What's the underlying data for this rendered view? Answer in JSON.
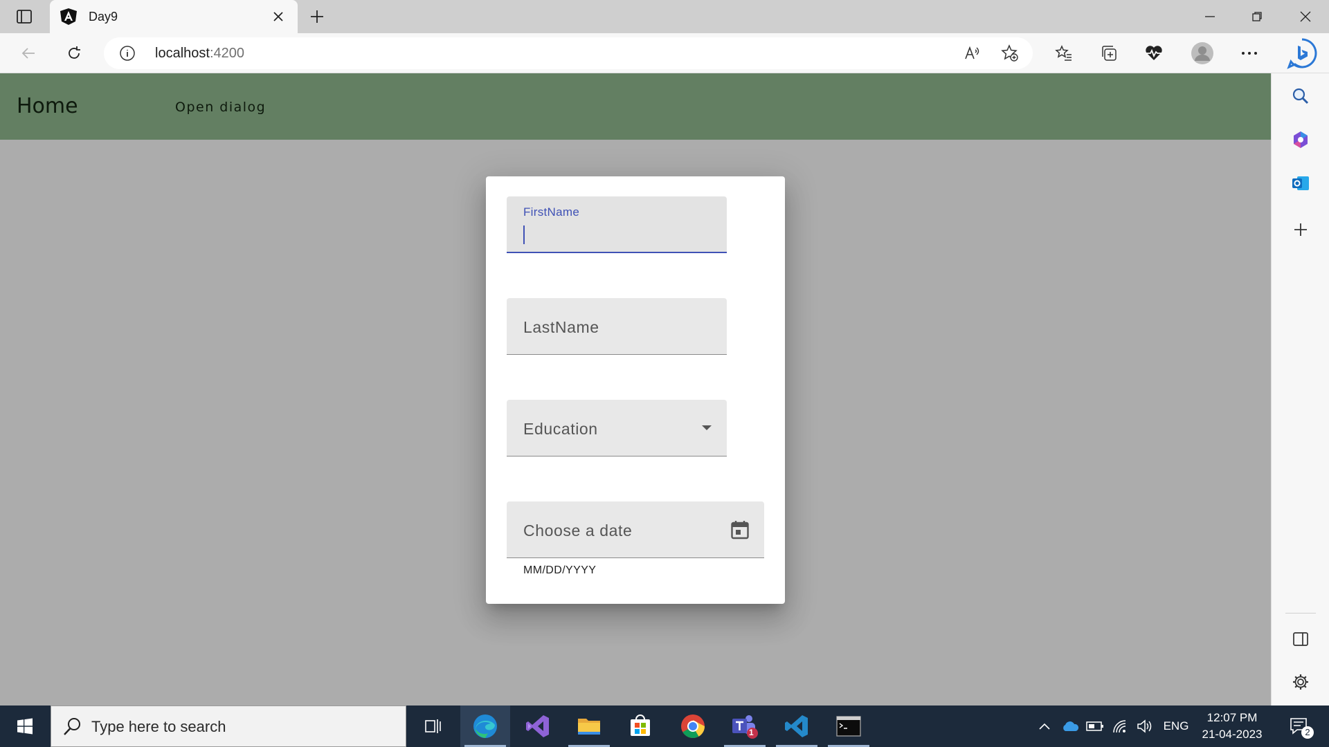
{
  "browser": {
    "tab": {
      "title": "Day9",
      "favicon": "angular-icon"
    },
    "address": {
      "host": "localhost",
      "port": ":4200"
    }
  },
  "app": {
    "nav": {
      "home_label": "Home",
      "open_dialog_label": "Open dialog"
    },
    "dialog": {
      "first_name": {
        "label": "FirstName",
        "value": ""
      },
      "last_name": {
        "placeholder": "LastName"
      },
      "education": {
        "placeholder": "Education"
      },
      "date": {
        "placeholder": "Choose a date",
        "hint": "MM/DD/YYYY"
      }
    }
  },
  "taskbar": {
    "search_placeholder": "Type here to search",
    "language": "ENG",
    "time": "12:07 PM",
    "date": "21-04-2023",
    "notification_count": "2",
    "teams_badge": "1"
  },
  "colors": {
    "nav_background": "#637f62",
    "overlay": "#acacac",
    "focus_accent": "#3f51b5",
    "taskbar": "#1c2a3b"
  }
}
